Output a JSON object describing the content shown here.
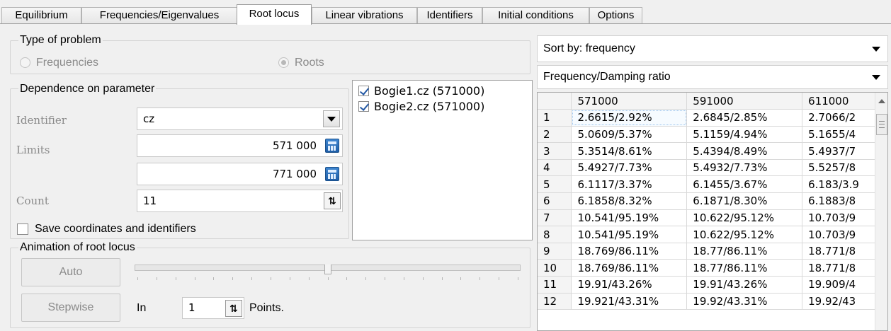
{
  "tabs": [
    {
      "label": "Equilibrium",
      "active": false
    },
    {
      "label": "Frequencies/Eigenvalues",
      "active": false
    },
    {
      "label": "Root locus",
      "active": true
    },
    {
      "label": "Linear vibrations",
      "active": false
    },
    {
      "label": "Identifiers",
      "active": false
    },
    {
      "label": "Initial conditions",
      "active": false
    },
    {
      "label": "Options",
      "active": false
    }
  ],
  "type_of_problem": {
    "title": "Type of problem",
    "option_frequencies": "Frequencies",
    "option_roots": "Roots",
    "selected": "Roots"
  },
  "dependence": {
    "title": "Dependence on parameter",
    "identifier_label": "Identifier",
    "identifier_value": "cz",
    "limits_label": "Limits",
    "limit_min": "571 000",
    "limit_max": "771 000",
    "count_label": "Count",
    "count_value": "11"
  },
  "identifiers_list": [
    {
      "label": "Bogie1.cz (571000)",
      "checked": true
    },
    {
      "label": "Bogie2.cz (571000)",
      "checked": true
    }
  ],
  "save_coordinates": {
    "label": "Save coordinates and identifiers",
    "checked": false
  },
  "animation": {
    "title": "Animation of root locus",
    "auto_label": "Auto",
    "stepwise_label": "Stepwise",
    "in_label": "In",
    "points_value": "1",
    "points_label": "Points.",
    "slider_position": 0.5
  },
  "sort_by": "Sort by: frequency",
  "display_mode": "Frequency/Damping ratio",
  "results_table": {
    "columns": [
      "",
      "571000",
      "591000",
      "611000"
    ],
    "rows": [
      [
        "1",
        "2.6615/2.92%",
        "2.6845/2.85%",
        "2.7066/2"
      ],
      [
        "2",
        "5.0609/5.37%",
        "5.1159/4.94%",
        "5.1655/4"
      ],
      [
        "3",
        "5.3514/8.61%",
        "5.4394/8.49%",
        "5.4937/7"
      ],
      [
        "4",
        "5.4927/7.73%",
        "5.4932/7.73%",
        "5.5257/8"
      ],
      [
        "5",
        "6.1117/3.37%",
        "6.1455/3.67%",
        "6.183/3.9"
      ],
      [
        "6",
        "6.1858/8.32%",
        "6.1871/8.30%",
        "6.1883/8"
      ],
      [
        "7",
        "10.541/95.19%",
        "10.622/95.12%",
        "10.703/9"
      ],
      [
        "8",
        "10.541/95.19%",
        "10.622/95.12%",
        "10.703/9"
      ],
      [
        "9",
        "18.769/86.11%",
        "18.77/86.11%",
        "18.771/8"
      ],
      [
        "10",
        "18.769/86.11%",
        "18.77/86.11%",
        "18.771/8"
      ],
      [
        "11",
        "19.91/43.26%",
        "19.91/43.26%",
        "19.909/4"
      ],
      [
        "12",
        "19.921/43.31%",
        "19.92/43.31%",
        "19.92/43"
      ]
    ]
  }
}
